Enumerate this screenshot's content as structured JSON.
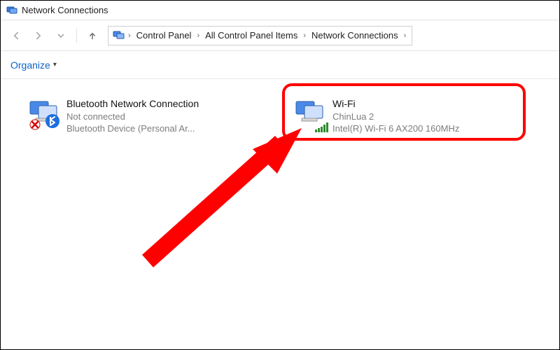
{
  "window": {
    "title": "Network Connections"
  },
  "breadcrumb": {
    "segments": [
      "Control Panel",
      "All Control Panel Items",
      "Network Connections"
    ]
  },
  "toolbar": {
    "organize_label": "Organize"
  },
  "connections": [
    {
      "name": "Bluetooth Network Connection",
      "status": "Not connected",
      "device": "Bluetooth Device (Personal Ar...",
      "type": "bluetooth",
      "disabled_overlay": true
    },
    {
      "name": "Wi-Fi",
      "status": "ChinLua 2",
      "device": "Intel(R) Wi-Fi 6 AX200 160MHz",
      "type": "wifi",
      "highlighted": true
    }
  ],
  "annotation": {
    "highlight_color": "#ff0000",
    "arrow_color": "#ff0000"
  }
}
